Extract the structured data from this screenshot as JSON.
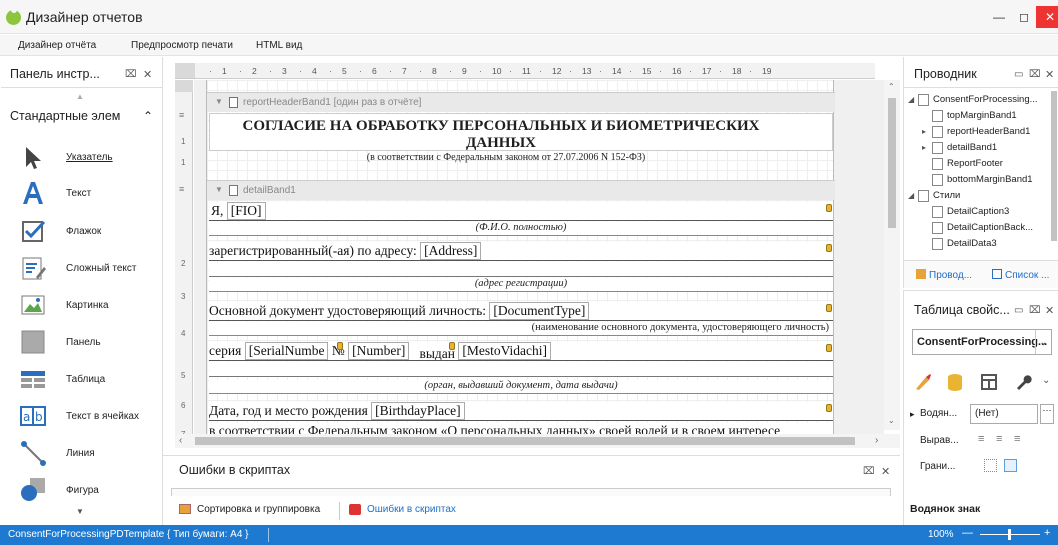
{
  "window": {
    "title": "Дизайнер отчетов"
  },
  "menu": [
    "Дизайнер отчёта",
    "Предпросмотр печати",
    "HTML вид"
  ],
  "toolbox": {
    "title": "Панель инстр...",
    "section": "Стандартные элем",
    "items": [
      {
        "label": "Указатель",
        "icon": "pointer-icon"
      },
      {
        "label": "Текст",
        "icon": "text-icon"
      },
      {
        "label": "Флажок",
        "icon": "checkbox-icon"
      },
      {
        "label": "Сложный текст",
        "icon": "rich-text-icon"
      },
      {
        "label": "Картинка",
        "icon": "picture-icon"
      },
      {
        "label": "Панель",
        "icon": "panel-icon"
      },
      {
        "label": "Таблица",
        "icon": "table-icon"
      },
      {
        "label": "Текст в ячейках",
        "icon": "character-comb-icon"
      },
      {
        "label": "Линия",
        "icon": "line-icon"
      },
      {
        "label": "Фигура",
        "icon": "shape-icon"
      }
    ]
  },
  "ruler": {
    "ticks": [
      "1",
      "2",
      "3",
      "4",
      "5",
      "6",
      "7",
      "8",
      "9",
      "10",
      "11",
      "12",
      "13",
      "14",
      "15",
      "16",
      "17",
      "18",
      "19"
    ],
    "vticks": [
      "1",
      "1",
      "2",
      "3",
      "4",
      "5",
      "6",
      "7"
    ]
  },
  "report": {
    "header_band": "reportHeaderBand1 [один раз в отчёте]",
    "title": "СОГЛАСИЕ НА ОБРАБОТКУ ПЕРСОНАЛЬНЫХ И БИОМЕТРИЧЕСКИХ ДАННЫХ",
    "subtitle": "(в соответствии с Федеральным законом от 27.07.2006 N 152-ФЗ)",
    "detail_band": "detailBand1",
    "r1_label": "Я,",
    "r1_field": "[FIO]",
    "r1_hint": "(Ф.И.О. полностью)",
    "r2_label": "зарегистрированный(-ая) по адресу:",
    "r2_field": "[Address]",
    "r2_hint": "(адрес регистрации)",
    "r3_label": "Основной документ удостоверяющий личность:",
    "r3_field": "[DocumentType]",
    "r3_hint": "(наименование основного документа, удостоверяющего личность)",
    "r4_label1": "серия",
    "r4_field1": "[SerialNumbe",
    "r4_label2": "№",
    "r4_field2": "[Number]",
    "r4_label3": "выдан",
    "r4_field3": "[MestoVidachi]",
    "r4_hint": "(орган, выдавший документ, дата выдачи)",
    "r5_label": "Дата, год и место рождения",
    "r5_field": "[BirthdayPlace]",
    "r6_text": "в соответствии с Федеральным законом «О персональных данных» своей волей и в своем интересе"
  },
  "errors": {
    "title": "Ошибки в скриптах",
    "tab1": "Сортировка и группировка",
    "tab2": "Ошибки в скриптах"
  },
  "explorer": {
    "title": "Проводник",
    "tab1": "Провод...",
    "tab2": "Список ...",
    "items": [
      {
        "label": "ConsentForProcessing...",
        "indent": 0
      },
      {
        "label": "topMarginBand1",
        "indent": 1
      },
      {
        "label": "reportHeaderBand1",
        "indent": 1
      },
      {
        "label": "detailBand1",
        "indent": 1
      },
      {
        "label": "ReportFooter",
        "indent": 1
      },
      {
        "label": "bottomMarginBand1",
        "indent": 1
      },
      {
        "label": "Стили",
        "indent": 0
      },
      {
        "label": "DetailCaption3",
        "indent": 1
      },
      {
        "label": "DetailCaptionBack...",
        "indent": 1
      },
      {
        "label": "DetailData3",
        "indent": 1
      }
    ]
  },
  "props": {
    "title": "Таблица свойс...",
    "selected": "ConsentForProcessing...",
    "p1_name": "Водян...",
    "p1_value": "(Нет)",
    "p2_name": "Вырав...",
    "p3_name": "Грани...",
    "desc": "Водянок знак"
  },
  "status": {
    "text": "ConsentForProcessingPDTemplate { Тип бумаги: A4 }",
    "zoom": "100%"
  },
  "colors": {
    "accent": "#1e7ad1",
    "marker": "#e8b431"
  }
}
